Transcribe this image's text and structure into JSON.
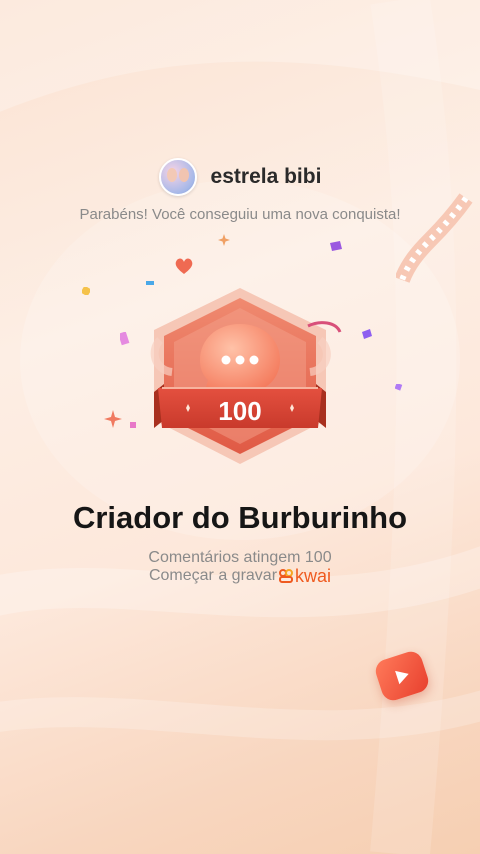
{
  "user": {
    "name": "estrela bibi"
  },
  "header": {
    "congrats": "Parabéns! Você conseguiu uma nova conquista!"
  },
  "badge": {
    "number": "100",
    "icon": "chat-bubble-icon"
  },
  "achievement": {
    "title": "Criador do Burburinho",
    "description": "Comentários atingem 100",
    "record_label": "Começar a gravar",
    "brand": "kwai"
  },
  "colors": {
    "accent": "#e8402e",
    "brand": "#ef5a1f",
    "badge_main": "#e65a4a"
  }
}
